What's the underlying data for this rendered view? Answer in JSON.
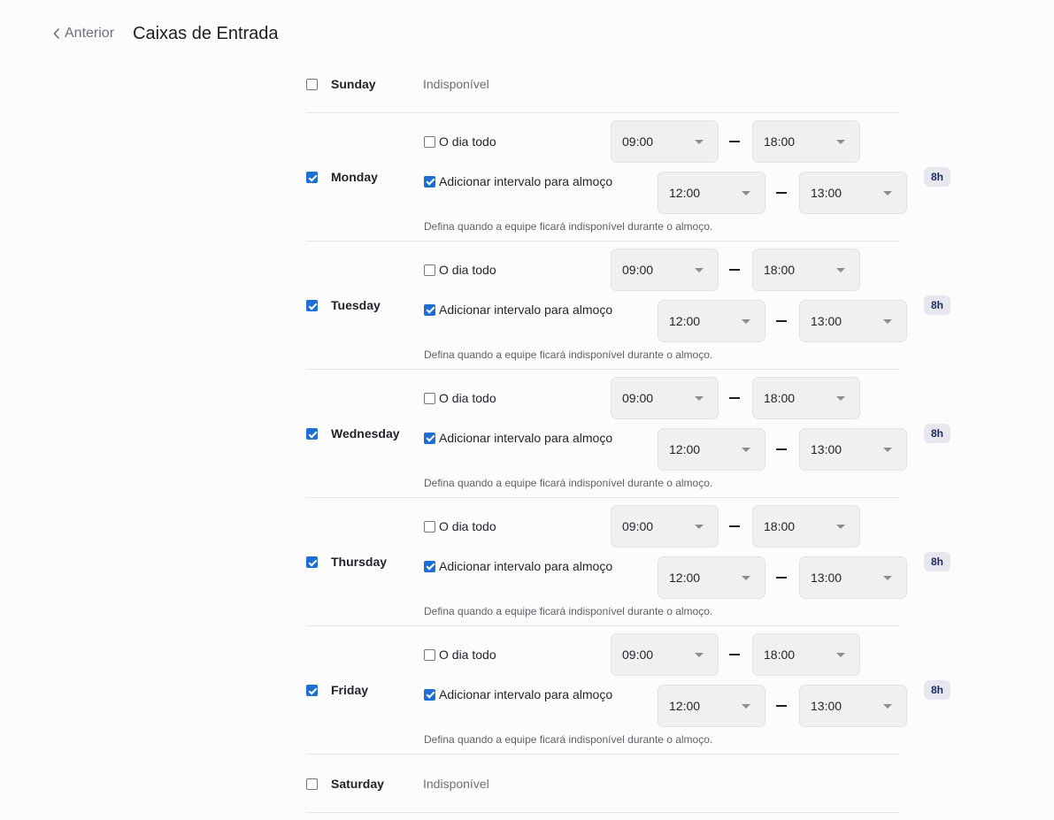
{
  "header": {
    "back_label": "Anterior",
    "title": "Caixas de Entrada"
  },
  "labels": {
    "all_day": "O dia todo",
    "lunch_break": "Adicionar intervalo para almoço",
    "lunch_hint": "Defina quando a equipe ficará indisponível durante o almoço.",
    "unavailable": "Indisponível"
  },
  "days": [
    {
      "name": "Sunday",
      "enabled": false,
      "status": "Indisponível"
    },
    {
      "name": "Monday",
      "enabled": true,
      "all_day": false,
      "lunch_enabled": true,
      "start": "09:00",
      "end": "18:00",
      "lunch_start": "12:00",
      "lunch_end": "13:00",
      "hours": "8h"
    },
    {
      "name": "Tuesday",
      "enabled": true,
      "all_day": false,
      "lunch_enabled": true,
      "start": "09:00",
      "end": "18:00",
      "lunch_start": "12:00",
      "lunch_end": "13:00",
      "hours": "8h"
    },
    {
      "name": "Wednesday",
      "enabled": true,
      "all_day": false,
      "lunch_enabled": true,
      "start": "09:00",
      "end": "18:00",
      "lunch_start": "12:00",
      "lunch_end": "13:00",
      "hours": "8h"
    },
    {
      "name": "Thursday",
      "enabled": true,
      "all_day": false,
      "lunch_enabled": true,
      "start": "09:00",
      "end": "18:00",
      "lunch_start": "12:00",
      "lunch_end": "13:00",
      "hours": "8h"
    },
    {
      "name": "Friday",
      "enabled": true,
      "all_day": false,
      "lunch_enabled": true,
      "start": "09:00",
      "end": "18:00",
      "lunch_start": "12:00",
      "lunch_end": "13:00",
      "hours": "8h"
    },
    {
      "name": "Saturday",
      "enabled": false,
      "status": "Indisponível"
    }
  ],
  "colors": {
    "accent": "#1f6ed4",
    "badge_bg": "#e7e7ef",
    "select_bg": "#f0f0f1"
  }
}
